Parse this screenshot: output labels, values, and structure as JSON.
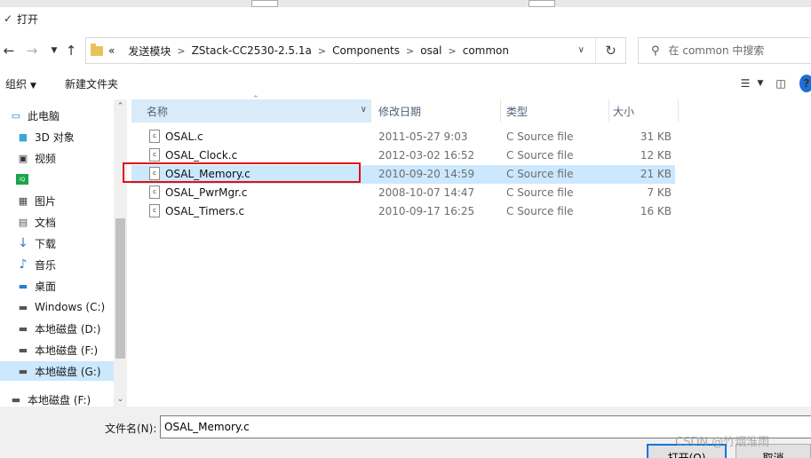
{
  "window": {
    "title": "打开"
  },
  "address": {
    "overflow": "«",
    "crumbs": [
      "发送模块",
      "ZStack-CC2530-2.5.1a",
      "Components",
      "osal",
      "common"
    ]
  },
  "search": {
    "placeholder": "在 common 中搜索"
  },
  "toolbar": {
    "organize": "组织",
    "new_folder": "新建文件夹"
  },
  "nav": {
    "items": [
      {
        "label": "此电脑",
        "icon": "computer-icon"
      },
      {
        "label": "3D 对象",
        "icon": "cube-icon"
      },
      {
        "label": "视频",
        "icon": "video-icon"
      },
      {
        "label": "",
        "icon": "iqiyi-icon"
      },
      {
        "label": "图片",
        "icon": "pictures-icon"
      },
      {
        "label": "文档",
        "icon": "documents-icon"
      },
      {
        "label": "下载",
        "icon": "download-icon"
      },
      {
        "label": "音乐",
        "icon": "music-icon"
      },
      {
        "label": "桌面",
        "icon": "desktop-icon"
      },
      {
        "label": "Windows (C:)",
        "icon": "drive-icon"
      },
      {
        "label": "本地磁盘 (D:)",
        "icon": "drive-icon"
      },
      {
        "label": "本地磁盘 (F:)",
        "icon": "drive-icon"
      },
      {
        "label": "本地磁盘 (G:)",
        "icon": "drive-icon",
        "selected": true
      },
      {
        "label": "本地磁盘 (F:)",
        "icon": "drive-icon"
      }
    ]
  },
  "columns": {
    "name": "名称",
    "date": "修改日期",
    "type": "类型",
    "size": "大小"
  },
  "files": [
    {
      "name": "OSAL.c",
      "date": "2011-05-27 9:03",
      "type": "C Source file",
      "size": "31 KB"
    },
    {
      "name": "OSAL_Clock.c",
      "date": "2012-03-02 16:52",
      "type": "C Source file",
      "size": "12 KB"
    },
    {
      "name": "OSAL_Memory.c",
      "date": "2010-09-20 14:59",
      "type": "C Source file",
      "size": "21 KB",
      "selected": true
    },
    {
      "name": "OSAL_PwrMgr.c",
      "date": "2008-10-07 14:47",
      "type": "C Source file",
      "size": "7 KB"
    },
    {
      "name": "OSAL_Timers.c",
      "date": "2010-09-17 16:25",
      "type": "C Source file",
      "size": "16 KB"
    }
  ],
  "file_icon_glyph": "c",
  "bottom": {
    "filename_label": "文件名(N):",
    "filename_value": "OSAL_Memory.c",
    "open_button": "打开(O)",
    "cancel_button": "取消"
  },
  "watermark": "CSDN @竹烟淮雨",
  "colors": {
    "selection": "#cce8ff",
    "highlight_box": "#e01010",
    "accent": "#0078d7"
  }
}
